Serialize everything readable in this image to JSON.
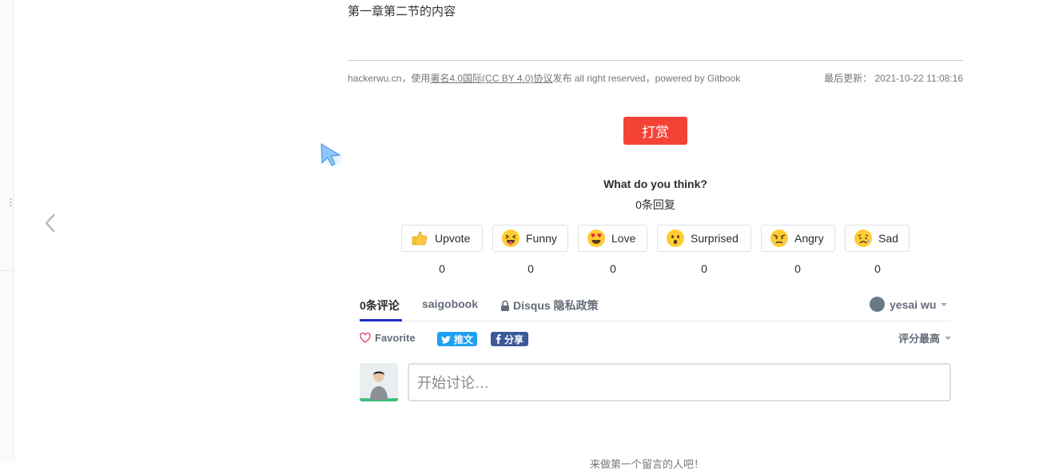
{
  "content": {
    "text": "第一章第二节的内容"
  },
  "footer": {
    "prefix": "hackerwu.cn，使用",
    "license_link": "署名4.0国际(CC BY 4.0)协议",
    "suffix": "发布 all right reserved，powered by Gitbook",
    "updated_label": "最后更新：",
    "updated_time": "2021-10-22 11:08:16"
  },
  "reward": {
    "label": "打赏"
  },
  "reactions": {
    "title": "What do you think?",
    "replies": "0条回复",
    "items": [
      {
        "label": "Upvote",
        "count": "0",
        "icon": "thumbs-up-icon"
      },
      {
        "label": "Funny",
        "count": "0",
        "icon": "tongue-face-icon"
      },
      {
        "label": "Love",
        "count": "0",
        "icon": "heart-eyes-icon"
      },
      {
        "label": "Surprised",
        "count": "0",
        "icon": "surprised-face-icon"
      },
      {
        "label": "Angry",
        "count": "0",
        "icon": "angry-face-icon"
      },
      {
        "label": "Sad",
        "count": "0",
        "icon": "sad-face-icon"
      }
    ]
  },
  "comments": {
    "tabs": [
      "0条评论",
      "saigobook",
      "Disqus 隐私政策"
    ],
    "user": "yesai wu",
    "favorite": "Favorite",
    "share_twitter": "推文",
    "share_facebook": "分享",
    "sort": "评分最高",
    "input_placeholder": "开始讨论…",
    "bottom_hint": "来做第一个留言的人吧！"
  },
  "colors": {
    "reward": "#f44336",
    "twitter": "#1da1f2",
    "facebook": "#3b5998",
    "active_tab": "#1d2bc6"
  }
}
